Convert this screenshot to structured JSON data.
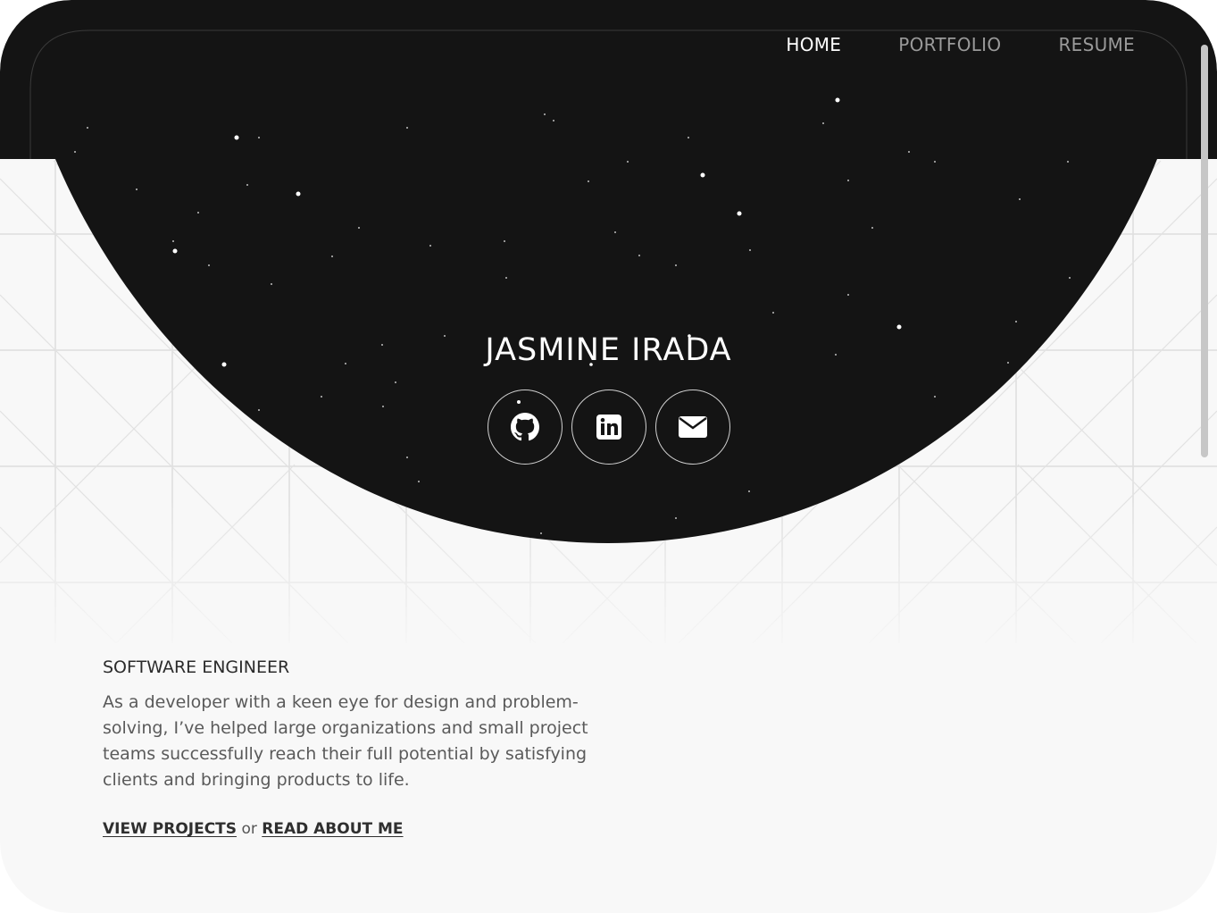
{
  "nav": {
    "items": [
      {
        "label": "HOME",
        "active": true
      },
      {
        "label": "PORTFOLIO",
        "active": false
      },
      {
        "label": "RESUME",
        "active": false
      }
    ]
  },
  "hero": {
    "name": "JASMINE IRADA",
    "social": [
      {
        "icon": "github-icon"
      },
      {
        "icon": "linkedin-icon"
      },
      {
        "icon": "mail-icon"
      }
    ]
  },
  "intro": {
    "role": "SOFTWARE ENGINEER",
    "bio": "As a developer with a keen eye for design and problem-solving, I’ve helped large organizations and small project teams successfully reach their full potential by satisfying clients and bringing products to life.",
    "link_projects": "VIEW PROJECTS",
    "link_separator": "or",
    "link_about": "READ ABOUT ME"
  },
  "colors": {
    "hero_bg": "#141414",
    "page_bg": "#f8f8f8",
    "grid_line": "#dcdcdc",
    "text_dark": "#2b2b2b",
    "text_body": "#5a5a5a"
  }
}
